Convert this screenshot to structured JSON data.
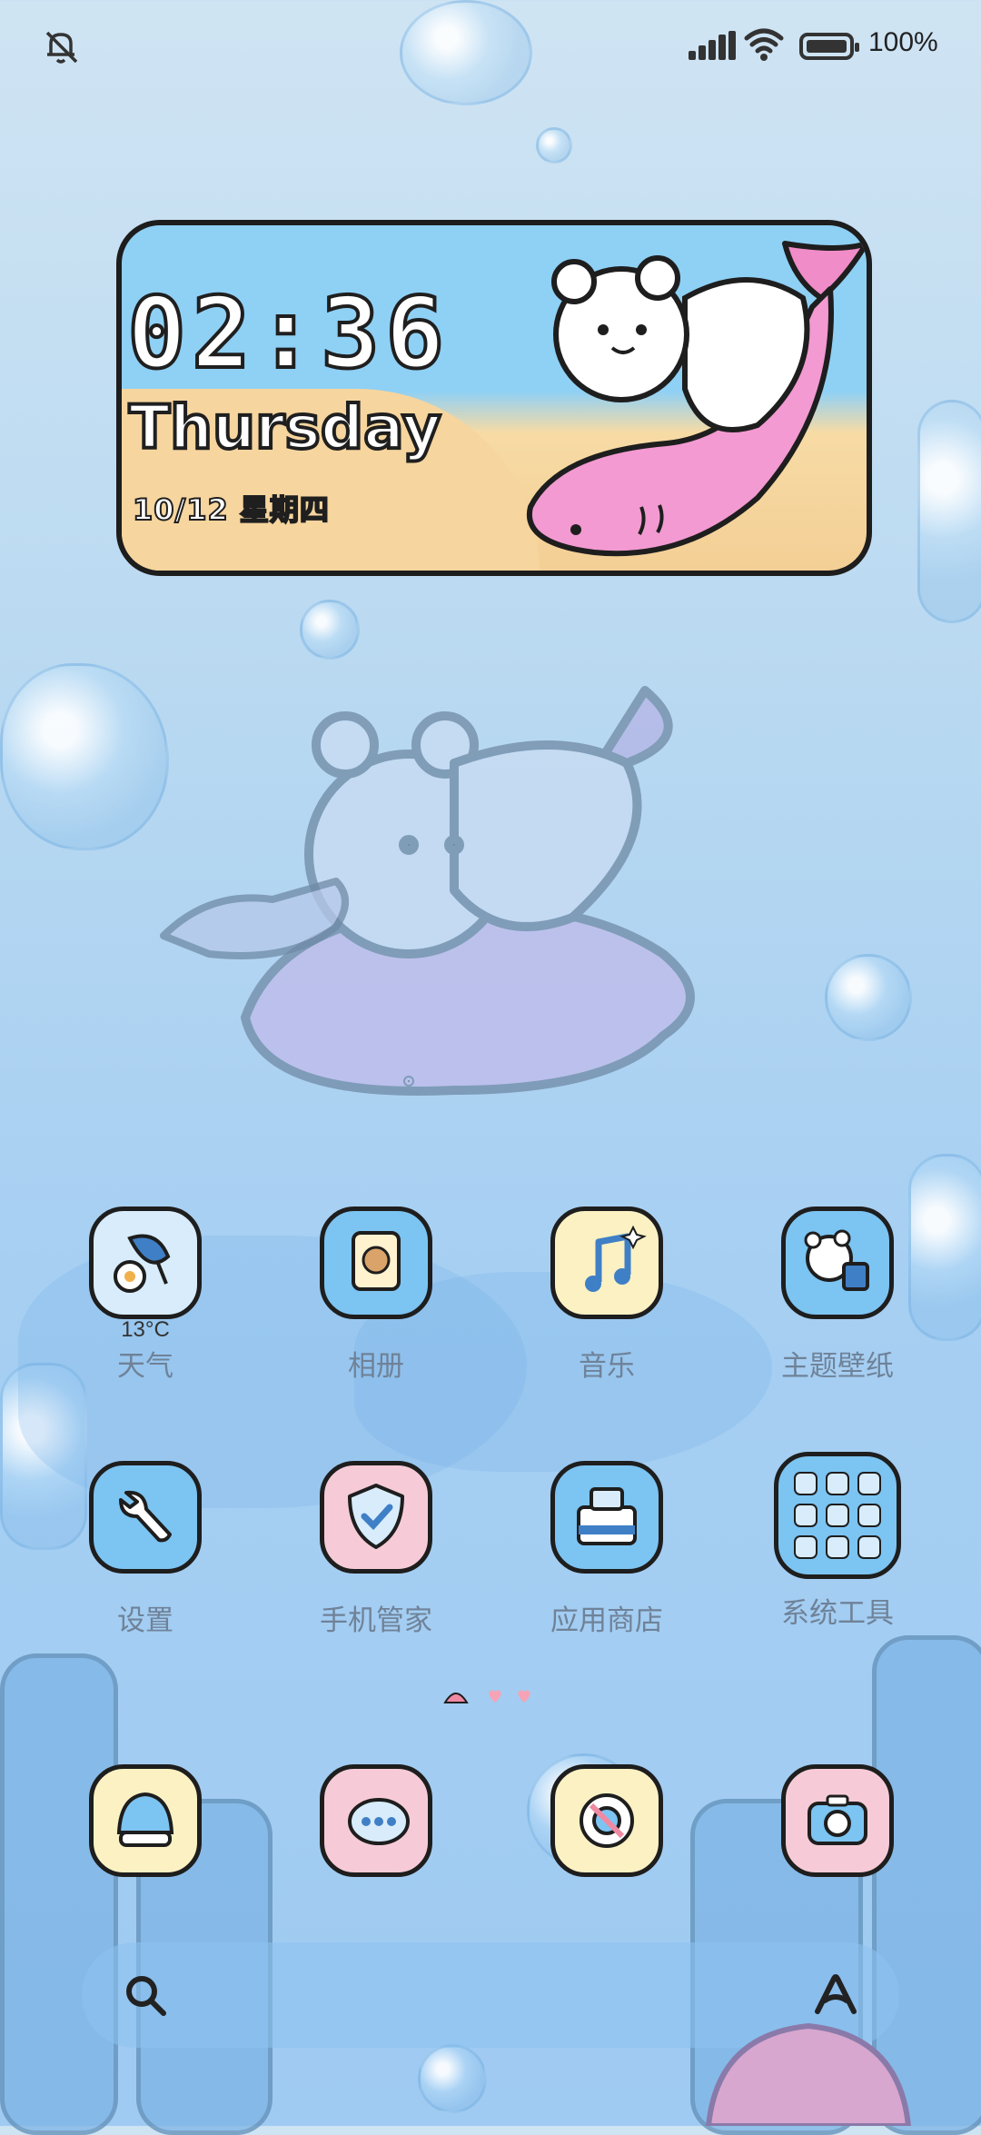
{
  "status_bar": {
    "battery_text": "100%",
    "icons": [
      "bell-muted-icon",
      "signal-icon",
      "wifi-icon",
      "battery-icon"
    ]
  },
  "widget": {
    "time": "02:36",
    "day": "Thursday",
    "date": "10/12 星期四"
  },
  "weather": {
    "temp": "13°C"
  },
  "apps_row1": [
    {
      "label": "天气",
      "icon": "weather-icon",
      "bg": "#d8ecfb"
    },
    {
      "label": "相册",
      "icon": "photo-album-icon",
      "bg": "#7cc4f2"
    },
    {
      "label": "音乐",
      "icon": "music-note-icon",
      "bg": "#fbf1c3"
    },
    {
      "label": "主题壁纸",
      "icon": "theme-bear-icon",
      "bg": "#7cc4f2"
    }
  ],
  "apps_row2": [
    {
      "label": "设置",
      "icon": "wrench-icon",
      "bg": "#7cc4f2"
    },
    {
      "label": "手机管家",
      "icon": "shield-check-icon",
      "bg": "#f6cbd7"
    },
    {
      "label": "应用商店",
      "icon": "store-bag-icon",
      "bg": "#7cc4f2"
    },
    {
      "label": "系统工具",
      "icon": "folder-grid-icon",
      "bg": "#7cc4f2"
    }
  ],
  "dock_apps": [
    {
      "icon": "phone-shell-icon",
      "bg": "#fbf1c3"
    },
    {
      "icon": "message-bubble-icon",
      "bg": "#f6cbd7"
    },
    {
      "icon": "browser-ring-icon",
      "bg": "#fbf1c3"
    },
    {
      "icon": "camera-icon",
      "bg": "#f6cbd7"
    }
  ],
  "page_indicator": {
    "pages": 3,
    "current": 1
  },
  "dock": {
    "icons": [
      "search-icon",
      "assistant-icon"
    ]
  }
}
